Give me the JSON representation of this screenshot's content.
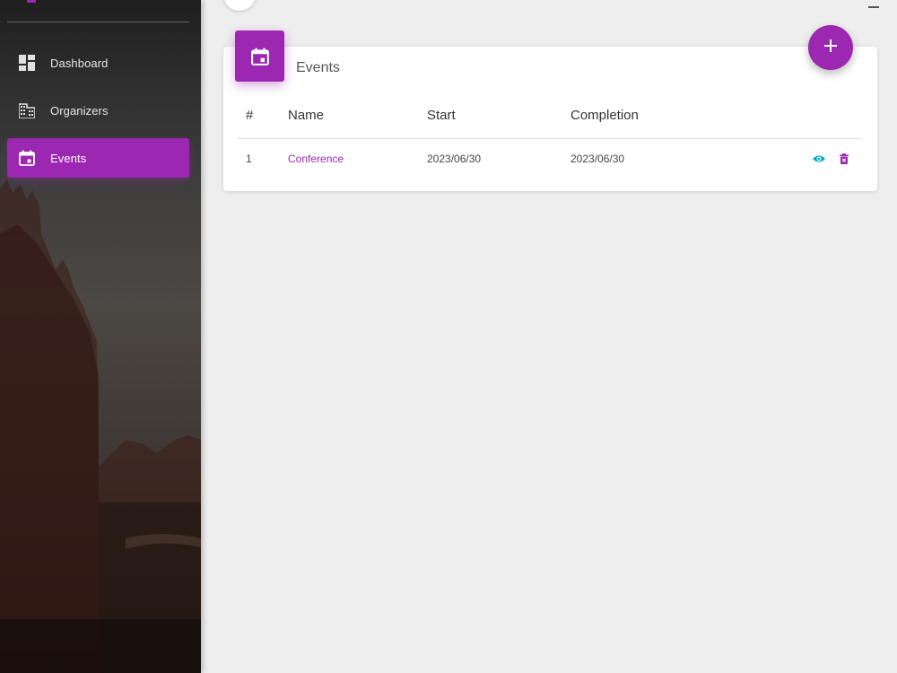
{
  "sidebar": {
    "items": [
      {
        "label": "Dashboard",
        "icon": "dashboard-icon",
        "active": false
      },
      {
        "label": "Organizers",
        "icon": "building-icon",
        "active": false
      },
      {
        "label": "Events",
        "icon": "calendar-icon",
        "active": true
      }
    ]
  },
  "card": {
    "title": "Events",
    "header_icon": "calendar-icon",
    "add_icon": "plus-icon"
  },
  "table": {
    "columns": [
      "#",
      "Name",
      "Start",
      "Completion"
    ],
    "rows": [
      {
        "index": "1",
        "name": "Conference",
        "start": "2023/06/30",
        "completion": "2023/06/30",
        "actions": [
          "view-icon",
          "delete-icon"
        ]
      }
    ]
  },
  "colors": {
    "accent": "#9c27b0",
    "view_icon": "#00acc1",
    "background": "#eeeeee"
  }
}
